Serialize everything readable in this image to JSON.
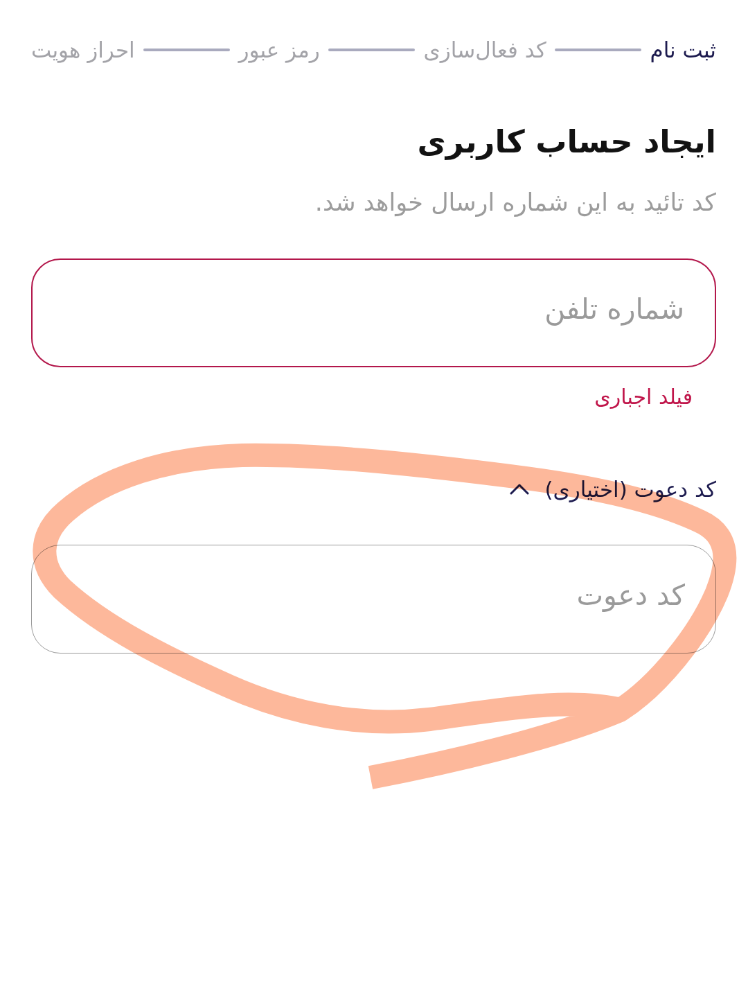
{
  "steps": [
    {
      "label": "ثبت نام",
      "current": true
    },
    {
      "label": "کد فعال‌سازی",
      "current": false
    },
    {
      "label": "رمز عبور",
      "current": false
    },
    {
      "label": "احراز هویت",
      "current": false
    }
  ],
  "title": "ایجاد حساب کاربری",
  "subtitle": "کد تائید به این شماره ارسال خواهد شد.",
  "phone_field": {
    "placeholder": "شماره تلفن",
    "invalid": true,
    "error": "فیلد اجباری"
  },
  "invite_section": {
    "label": "کد دعوت (اختیاری)",
    "expanded": true,
    "field": {
      "placeholder": "کد دعوت"
    }
  },
  "annotation": {
    "kind": "loop"
  }
}
